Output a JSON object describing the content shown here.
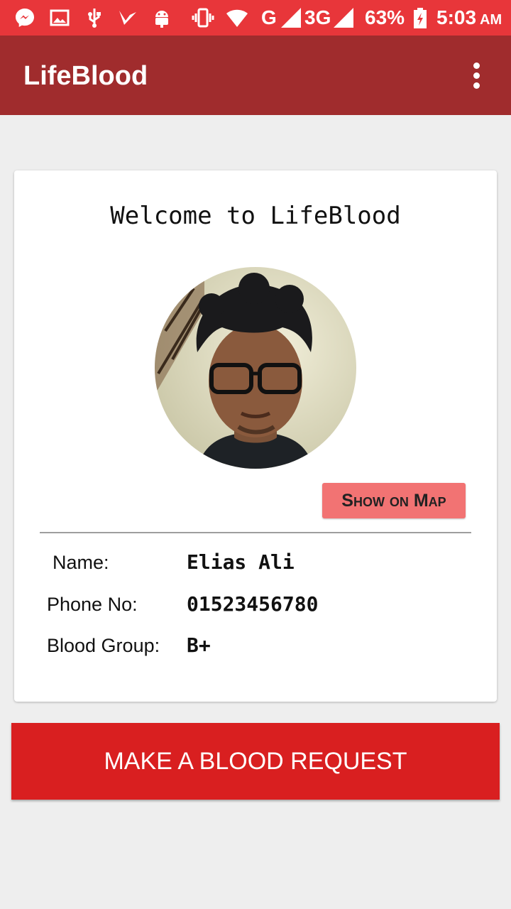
{
  "status_bar": {
    "network_type_1": "G",
    "network_type_2": "3G",
    "battery_percent": "63%",
    "time": "5:03",
    "ampm": "AM",
    "icons": [
      "messenger-icon",
      "image-icon",
      "usb-icon",
      "check-icon",
      "android-icon",
      "vibrate-icon",
      "wifi-icon",
      "signal-icon",
      "signal-icon",
      "battery-icon"
    ]
  },
  "app_bar": {
    "title": "LifeBlood",
    "menu_icon": "more-vert-icon"
  },
  "card": {
    "welcome": "Welcome to LifeBlood",
    "show_on_map": "Show on Map",
    "fields": [
      {
        "label": "Name:",
        "value": "Elias Ali"
      },
      {
        "label": "Phone No:",
        "value": "01523456780"
      },
      {
        "label": "Blood Group:",
        "value": "B+"
      }
    ]
  },
  "request_button": "MAKE A BLOOD REQUEST",
  "colors": {
    "status_bar": "#e8363a",
    "app_bar": "#a02c2d",
    "request_button": "#d91f20",
    "map_button": "#f27373"
  }
}
